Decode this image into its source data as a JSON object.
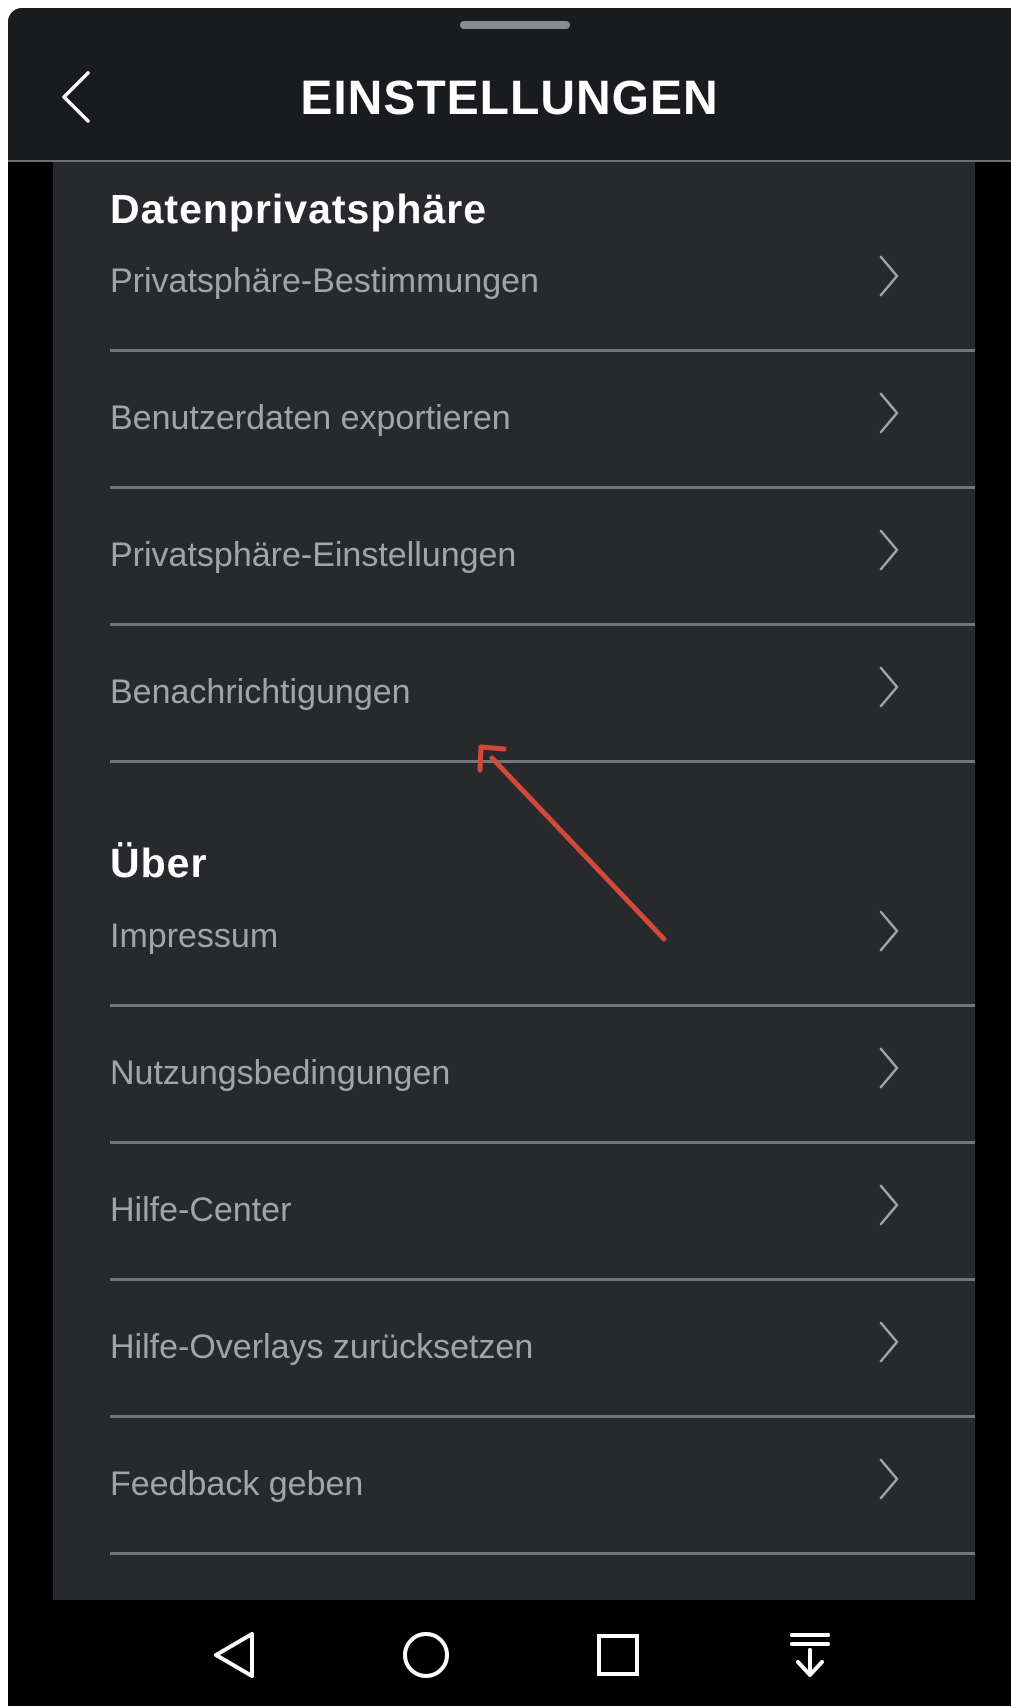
{
  "header": {
    "title": "EINSTELLUNGEN",
    "back_icon": "chevron-left-icon"
  },
  "sections": [
    {
      "title": "Datenprivatsphäre",
      "items": [
        {
          "label": "Privatsphäre-Bestimmungen"
        },
        {
          "label": "Benutzerdaten exportieren"
        },
        {
          "label": "Privatsphäre-Einstellungen"
        },
        {
          "label": "Benachrichtigungen"
        }
      ]
    },
    {
      "title": "Über",
      "items": [
        {
          "label": "Impressum"
        },
        {
          "label": "Nutzungsbedingungen"
        },
        {
          "label": "Hilfe-Center"
        },
        {
          "label": "Hilfe-Overlays zurücksetzen"
        },
        {
          "label": "Feedback geben"
        }
      ]
    }
  ],
  "annotation": {
    "target": "Benachrichtigungen",
    "color": "#d0493a"
  },
  "nav_bar": {
    "buttons": [
      "back-triangle-icon",
      "home-circle-icon",
      "recents-square-icon",
      "notification-pull-down-icon"
    ]
  },
  "colors": {
    "background": "#27292d",
    "header": "#1a1b1e",
    "label": "#a2a4a8",
    "section_title": "#ffffff",
    "divider": "#74767b"
  }
}
